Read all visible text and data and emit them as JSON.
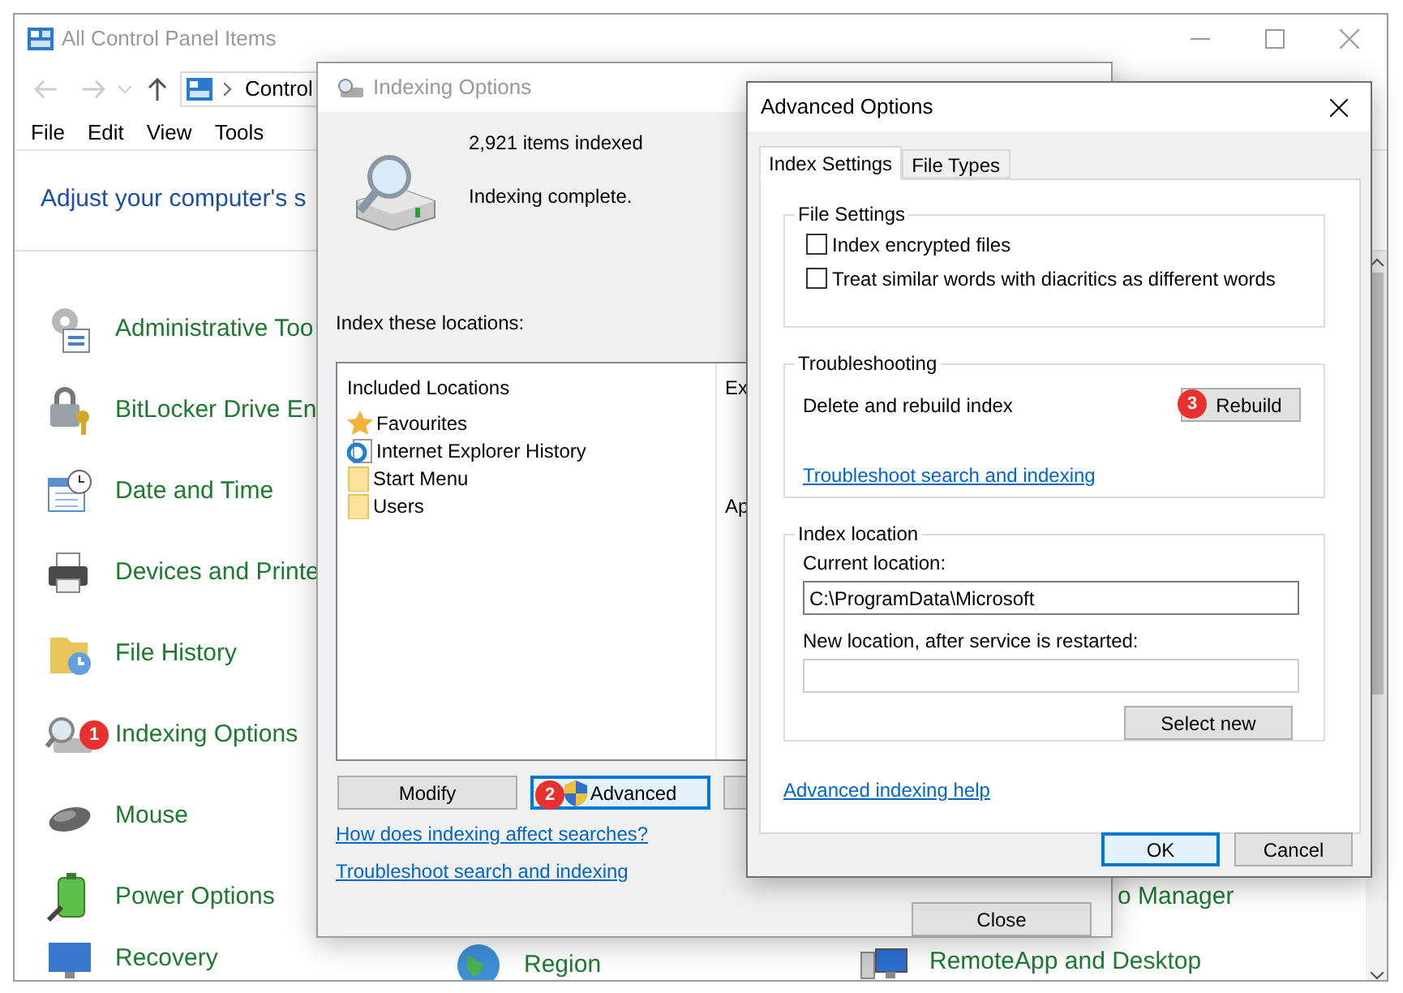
{
  "main_window": {
    "title": "All Control Panel Items",
    "address": "Control",
    "menu": [
      "File",
      "Edit",
      "View",
      "Tools"
    ],
    "heading": "Adjust your computer's s",
    "left_items": [
      {
        "label": "Administrative Too"
      },
      {
        "label": "BitLocker Drive En"
      },
      {
        "label": "Date and Time"
      },
      {
        "label": "Devices and Printe"
      },
      {
        "label": "File History"
      },
      {
        "label": "Indexing Options",
        "badge": "1"
      },
      {
        "label": "Mouse"
      },
      {
        "label": "Power Options"
      },
      {
        "label": "Recovery"
      }
    ],
    "middle_items": [
      {
        "label": "Region"
      }
    ],
    "right_items": [
      {
        "label": "o Manager"
      },
      {
        "label": "RemoteApp and Desktop"
      }
    ]
  },
  "indexing_dialog": {
    "title": "Indexing Options",
    "count": "2,921 items indexed",
    "status": "Indexing complete.",
    "locations_label": "Index these locations:",
    "columns": [
      "Included Locations",
      "Ex"
    ],
    "locations": [
      {
        "name": "Favourites"
      },
      {
        "name": "Internet Explorer History"
      },
      {
        "name": "Start Menu"
      },
      {
        "name": "Users",
        "column_2": "Ap"
      }
    ],
    "buttons": [
      {
        "label": "Modify",
        "focused": false
      },
      {
        "label": "Advanced",
        "focused": true,
        "badge": "2"
      },
      {
        "focused": false
      }
    ],
    "links": [
      "How does indexing affect searches?",
      "Troubleshoot search and indexing"
    ],
    "close_button": "Close"
  },
  "advanced_dialog": {
    "title": "Advanced Options",
    "tabs": [
      {
        "label": "Index Settings",
        "selected": true
      },
      {
        "label": "File Types",
        "selected": false
      }
    ],
    "file_settings": {
      "title": "File Settings",
      "options": [
        {
          "label": "Index encrypted files",
          "checked": false
        },
        {
          "label": "Treat similar words with diacritics as different words",
          "checked": false
        }
      ]
    },
    "troubleshooting": {
      "title": "Troubleshooting",
      "text": "Delete and rebuild index",
      "button": {
        "label": "Rebuild",
        "badge": "3"
      },
      "link": "Troubleshoot search and indexing"
    },
    "index_location": {
      "title": "Index location",
      "current_label": "Current location:",
      "current_value": "C:\\ProgramData\\Microsoft",
      "new_label": "New location, after service is restarted:",
      "select_button": "Select new"
    },
    "help_link": "Advanced indexing help",
    "buttons": [
      {
        "label": "OK",
        "focused": true
      },
      {
        "label": "Cancel",
        "focused": false
      }
    ]
  }
}
